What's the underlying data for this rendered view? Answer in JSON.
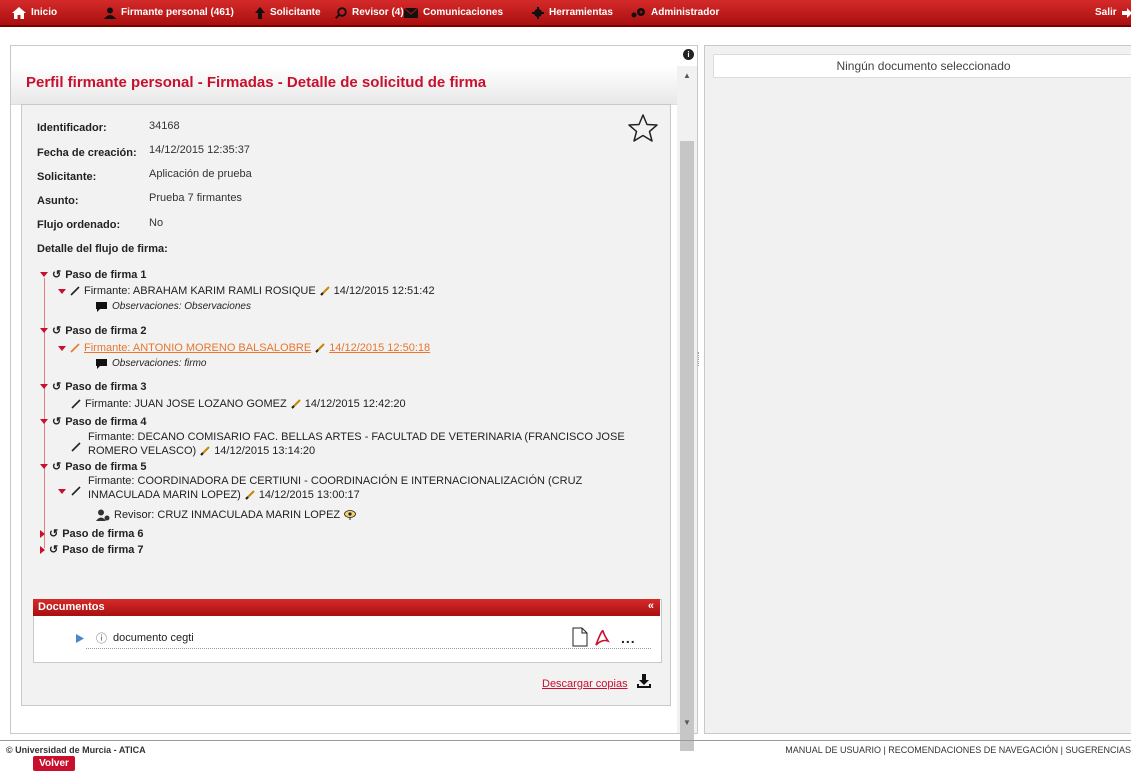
{
  "nav": {
    "inicio": "Inicio",
    "firmante": "Firmante personal (461)",
    "solicitante": "Solicitante",
    "revisor": "Revisor (4)",
    "comunicaciones": "Comunicaciones",
    "herramientas": "Herramientas",
    "administrador": "Administrador",
    "salir": "Salir"
  },
  "page": {
    "title": "Perfil firmante personal - Firmadas - Detalle de solicitud de firma"
  },
  "detail": {
    "identificador_label": "Identificador:",
    "identificador": "34168",
    "fecha_label": "Fecha de creación:",
    "fecha": "14/12/2015 12:35:37",
    "solicitante_label": "Solicitante:",
    "solicitante": "Aplicación de prueba",
    "asunto_label": "Asunto:",
    "asunto": "Prueba 7 firmantes",
    "flujo_label": "Flujo ordenado:",
    "flujo": "No",
    "flow_header": "Detalle del flujo de firma:"
  },
  "steps": {
    "s1": "Paso de firma 1",
    "s1_firmante": "Firmante: ABRAHAM KARIM RAMLI ROSIQUE",
    "s1_date": "14/12/2015 12:51:42",
    "s1_obs": "Observaciones: Observaciones",
    "s2": "Paso de firma 2",
    "s2_firmante": "Firmante: ANTONIO MORENO BALSALOBRE",
    "s2_date": "14/12/2015 12:50:18",
    "s2_obs": "Observaciones: firmo",
    "s3": "Paso de firma 3",
    "s3_firmante": "Firmante: JUAN JOSE LOZANO GOMEZ",
    "s3_date": "14/12/2015 12:42:20",
    "s4": "Paso de firma 4",
    "s4_firmante_l1": "Firmante: DECANO COMISARIO FAC. BELLAS ARTES - FACULTAD DE VETERINARIA (FRANCISCO JOSE",
    "s4_firmante_l2": "ROMERO VELASCO)",
    "s4_date": "14/12/2015 13:14:20",
    "s5": "Paso de firma 5",
    "s5_firmante_l1": "Firmante: COORDINADORA DE CERTIUNI - COORDINACIÓN E INTERNACIONALIZACIÓN (CRUZ",
    "s5_firmante_l2": "INMACULADA MARIN LOPEZ)",
    "s5_date": "14/12/2015 13:00:17",
    "s5_revisor": "Revisor: CRUZ INMACULADA MARIN LOPEZ",
    "s6": "Paso de firma 6",
    "s7": "Paso de firma 7"
  },
  "documents": {
    "header": "Documentos",
    "collapse": "«",
    "doc_name": "documento cegti",
    "info": "ⓘ",
    "more": "...",
    "download": "Descargar copias"
  },
  "buttons": {
    "volver": "Volver"
  },
  "right": {
    "no_doc": "Ningún documento seleccionado"
  },
  "footer": {
    "left": "© Universidad de Murcia - ATICA",
    "right": "MANUAL DE USUARIO | RECOMENDACIONES DE NAVEGACIÓN | SUGERENCIAS"
  },
  "colors": {
    "brand_red": "#c8102e",
    "link_orange": "#e8762d"
  },
  "icons": [
    "home-icon",
    "user-icon",
    "arrow-up-icon",
    "search-icon",
    "mail-icon",
    "gear-icon",
    "admin-gear-icon",
    "logout-icon",
    "star-icon",
    "pencil-icon",
    "comment-icon",
    "reviewer-icon",
    "eye-icon",
    "file-icon",
    "pdf-icon",
    "download-icon",
    "play-icon",
    "info-icon"
  ]
}
